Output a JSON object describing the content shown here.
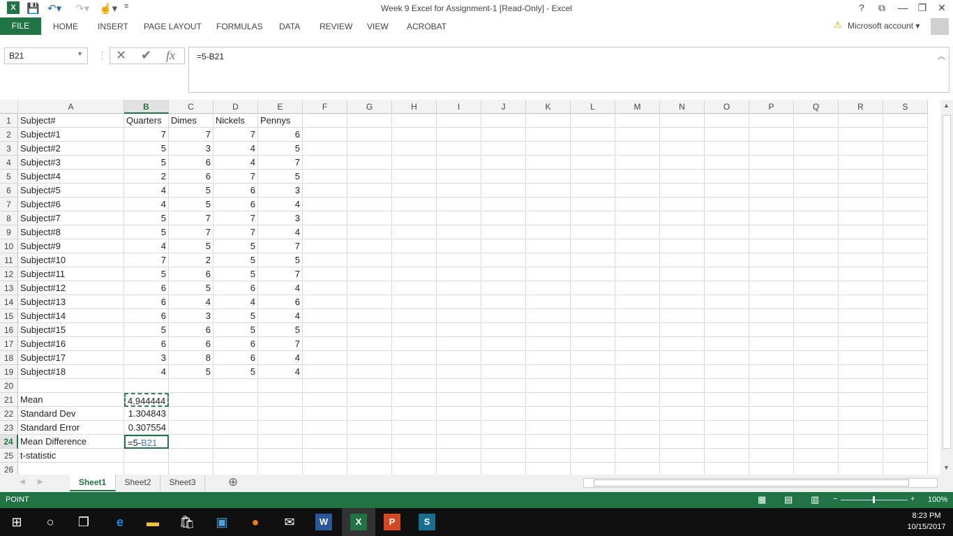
{
  "window": {
    "title": "Week 9 Excel for Assignment-1  [Read-Only] - Excel",
    "help": "?",
    "restore_ribbon": "⧉",
    "minimize": "—",
    "maximize": "❐",
    "close": "✕"
  },
  "ribbon": {
    "file": "FILE",
    "tabs": [
      "HOME",
      "INSERT",
      "PAGE LAYOUT",
      "FORMULAS",
      "DATA",
      "REVIEW",
      "VIEW",
      "ACROBAT"
    ],
    "account": "Microsoft account"
  },
  "formula_bar": {
    "name_box": "B21",
    "formula": "=5-B21",
    "fx": "fx"
  },
  "columns": [
    "A",
    "B",
    "C",
    "D",
    "E",
    "F",
    "G",
    "H",
    "I",
    "J",
    "K",
    "L",
    "M",
    "N",
    "O",
    "P",
    "Q",
    "R",
    "S"
  ],
  "rows": [
    [
      "Subject#",
      "Quarters",
      "Dimes",
      "Nickels",
      "Pennys"
    ],
    [
      "Subject#1",
      "7",
      "7",
      "7",
      "6"
    ],
    [
      "Subject#2",
      "5",
      "3",
      "4",
      "5"
    ],
    [
      "Subject#3",
      "5",
      "6",
      "4",
      "7"
    ],
    [
      "Subject#4",
      "2",
      "6",
      "7",
      "5"
    ],
    [
      "Subject#5",
      "4",
      "5",
      "6",
      "3"
    ],
    [
      "Subject#6",
      "4",
      "5",
      "6",
      "4"
    ],
    [
      "Subject#7",
      "5",
      "7",
      "7",
      "3"
    ],
    [
      "Subject#8",
      "5",
      "7",
      "7",
      "4"
    ],
    [
      "Subject#9",
      "4",
      "5",
      "5",
      "7"
    ],
    [
      "Subject#10",
      "7",
      "2",
      "5",
      "5"
    ],
    [
      "Subject#11",
      "5",
      "6",
      "5",
      "7"
    ],
    [
      "Subject#12",
      "6",
      "5",
      "6",
      "4"
    ],
    [
      "Subject#13",
      "6",
      "4",
      "4",
      "6"
    ],
    [
      "Subject#14",
      "6",
      "3",
      "5",
      "4"
    ],
    [
      "Subject#15",
      "5",
      "6",
      "5",
      "5"
    ],
    [
      "Subject#16",
      "6",
      "6",
      "6",
      "7"
    ],
    [
      "Subject#17",
      "3",
      "8",
      "6",
      "4"
    ],
    [
      "Subject#18",
      "4",
      "5",
      "5",
      "4"
    ],
    [
      "",
      ""
    ],
    [
      "Mean",
      "4.944444"
    ],
    [
      "Standard Dev",
      "1.304843"
    ],
    [
      "Standard Error",
      "0.307554"
    ],
    [
      "Mean Difference",
      "=5-B21"
    ],
    [
      "t-statistic",
      ""
    ],
    [
      "",
      ""
    ]
  ],
  "sheets": [
    "Sheet1",
    "Sheet2",
    "Sheet3"
  ],
  "active_sheet": "Sheet1",
  "status": {
    "mode": "POINT",
    "zoom": "100%"
  },
  "taskbar": {
    "time": "8:23 PM",
    "date": "10/15/2017"
  },
  "colors": {
    "accent": "#217346"
  }
}
